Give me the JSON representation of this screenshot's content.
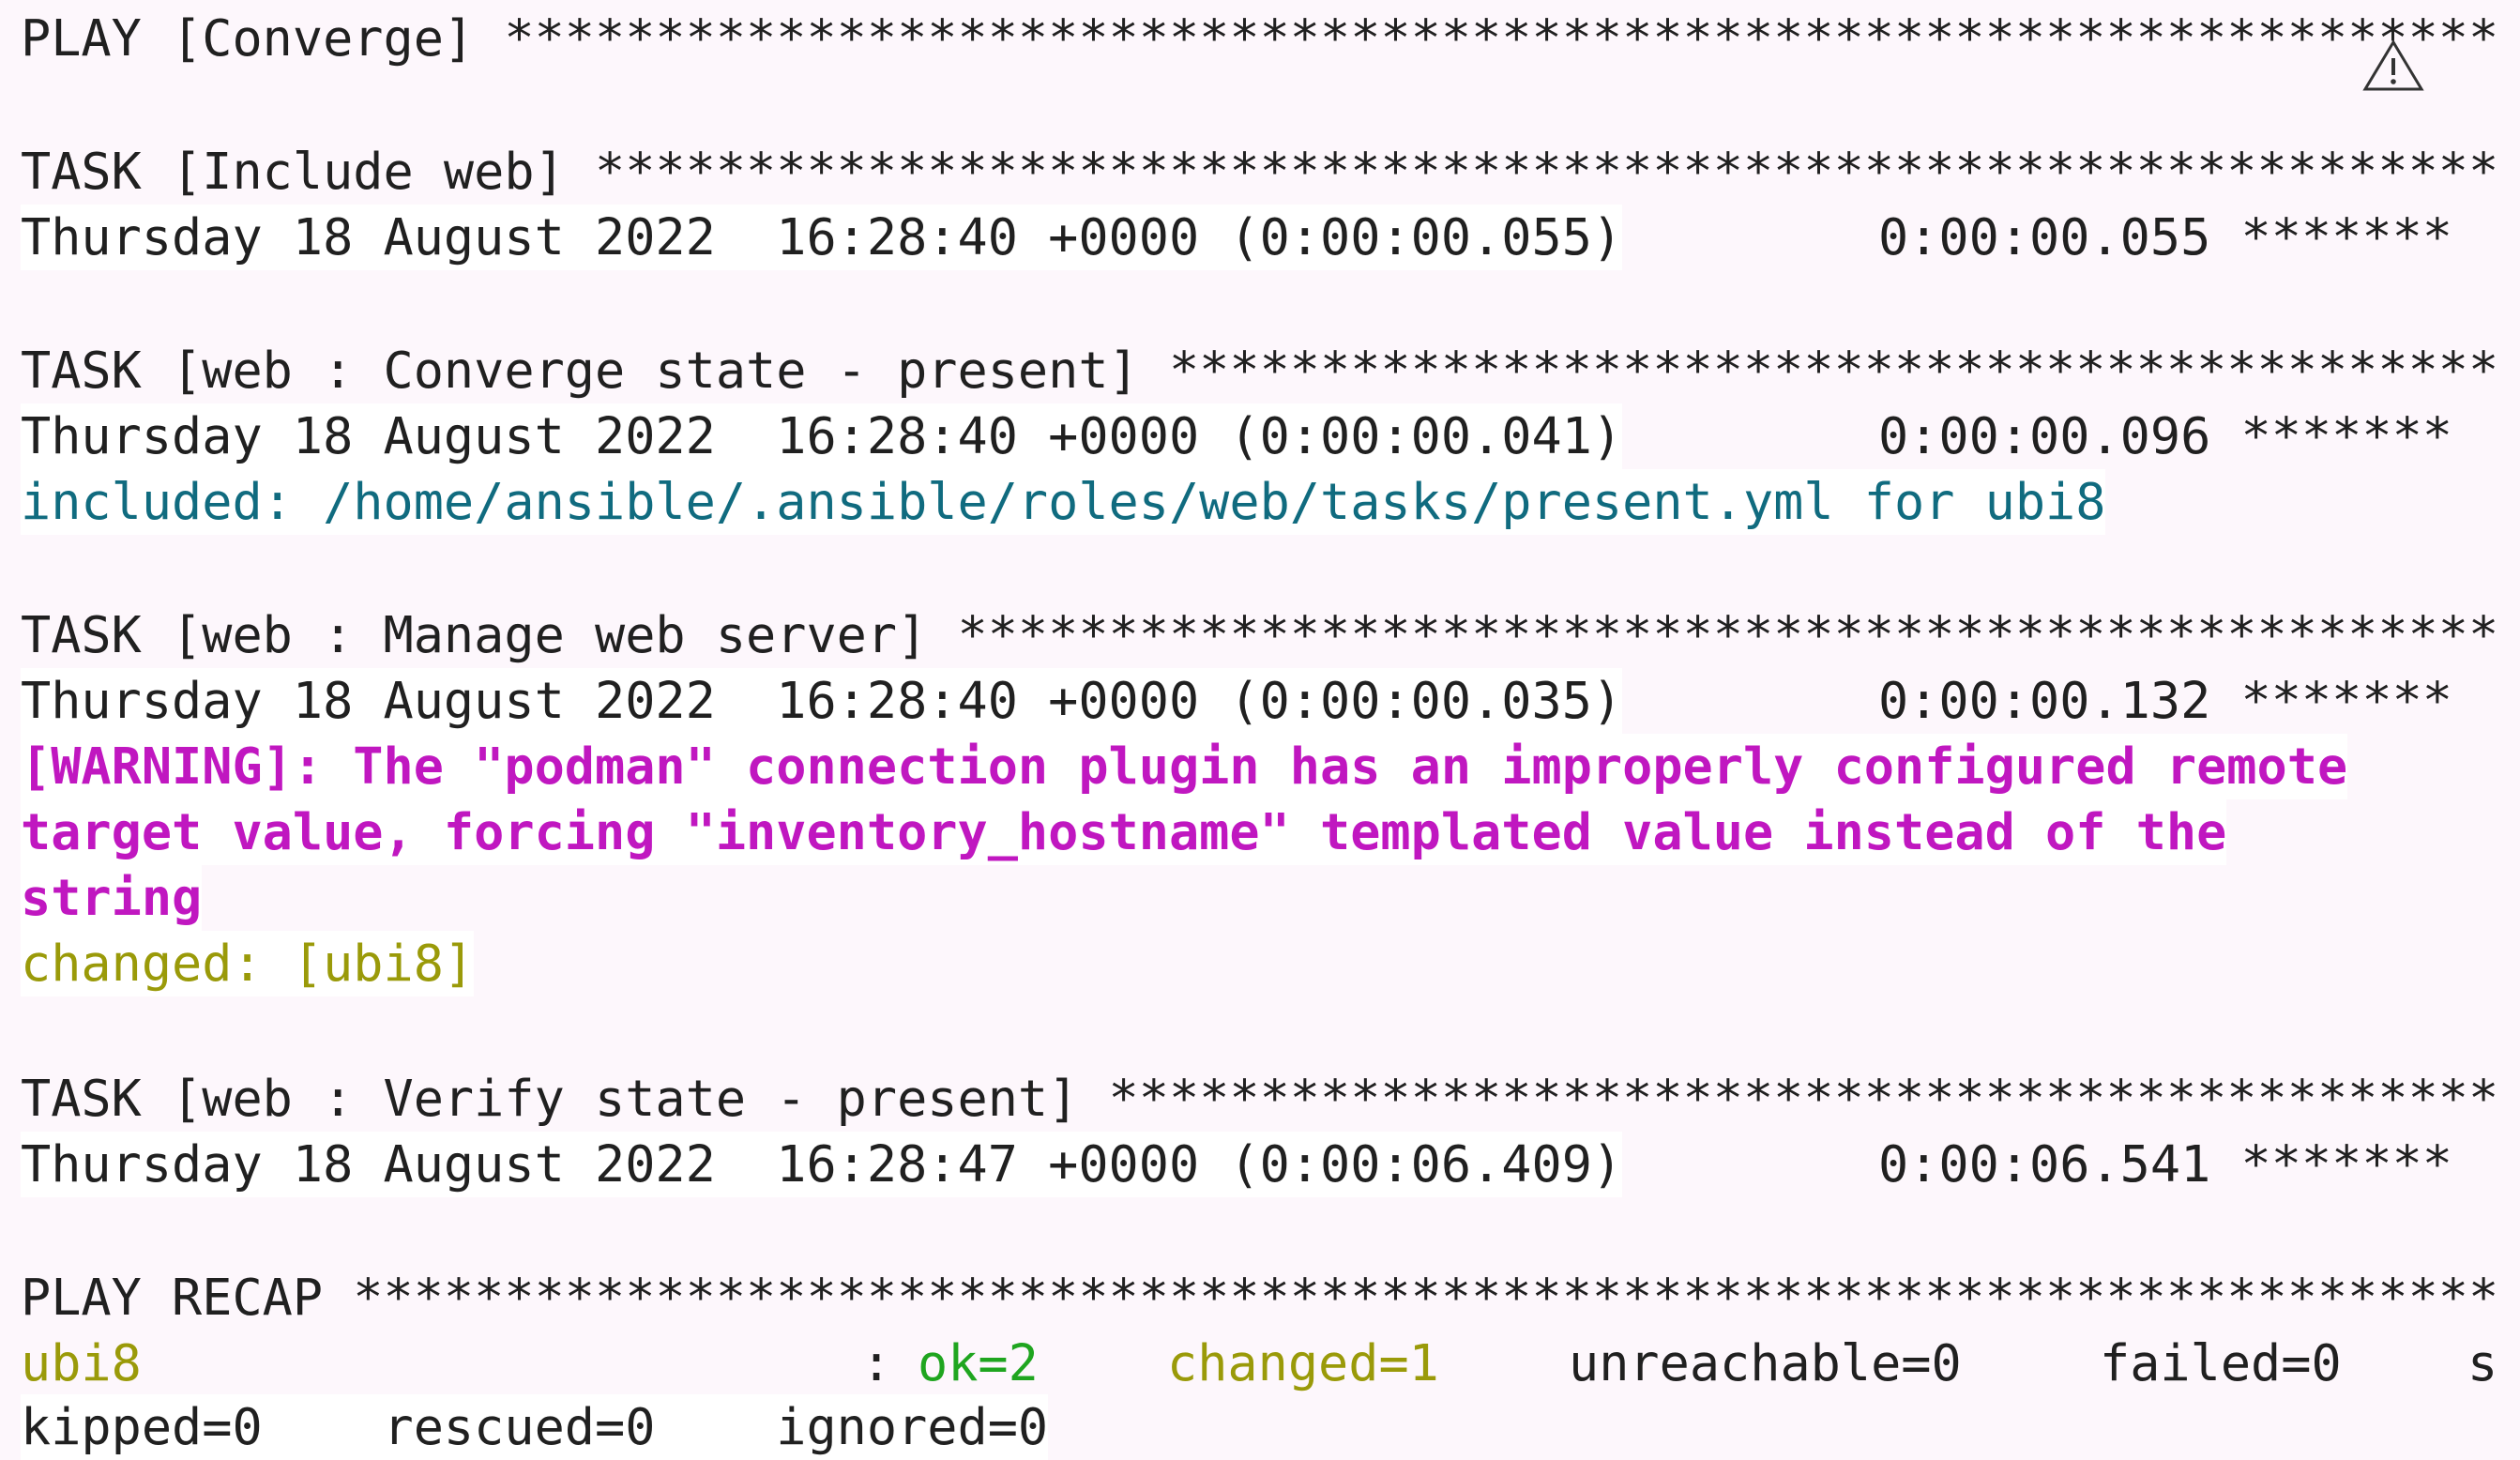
{
  "lines": {
    "play_converge": "PLAY [Converge] ******************************************************************",
    "task_include_web": "TASK [Include web] ***************************************************************",
    "ts1_time": "Thursday 18 August 2022  16:28:40 +0000 (0:00:00.055)",
    "ts1_total": "0:00:00.055 *******",
    "task_converge_state": "TASK [web : Converge state - present] ********************************************",
    "ts2_time": "Thursday 18 August 2022  16:28:40 +0000 (0:00:00.041)",
    "ts2_total": "0:00:00.096 *******",
    "included": "included: /home/ansible/.ansible/roles/web/tasks/present.yml for ubi8",
    "task_manage_web": "TASK [web : Manage web server] ***************************************************",
    "ts3_time": "Thursday 18 August 2022  16:28:40 +0000 (0:00:00.035)",
    "ts3_total": "0:00:00.132 *******",
    "warning_1": "[WARNING]: The \"podman\" connection plugin has an improperly configured remote",
    "warning_2": "target value, forcing \"inventory_hostname\" templated value instead of the",
    "warning_3": "string",
    "changed": "changed: [ubi8]",
    "task_verify_state": "TASK [web : Verify state - present] **********************************************",
    "ts4_time": "Thursday 18 August 2022  16:28:47 +0000 (0:00:06.409)",
    "ts4_total": "0:00:06.541 *******",
    "play_recap": "PLAY RECAP ***********************************************************************",
    "recap_host": "ubi8",
    "recap_colon": ":",
    "recap_ok": "ok=2",
    "recap_changed": "changed=1",
    "recap_unreachable": "unreachable=0",
    "recap_failed": "failed=0",
    "recap_s": "s",
    "recap_line2": "kipped=0    rescued=0    ignored=0"
  },
  "colors": {
    "background": "#fdf7fc",
    "text": "#202020",
    "included": "#106b7f",
    "warning": "#c017c0",
    "changed": "#9a9a09",
    "ok": "#1fa51f"
  },
  "icons": {
    "overlay": "warning-triangle-icon"
  }
}
